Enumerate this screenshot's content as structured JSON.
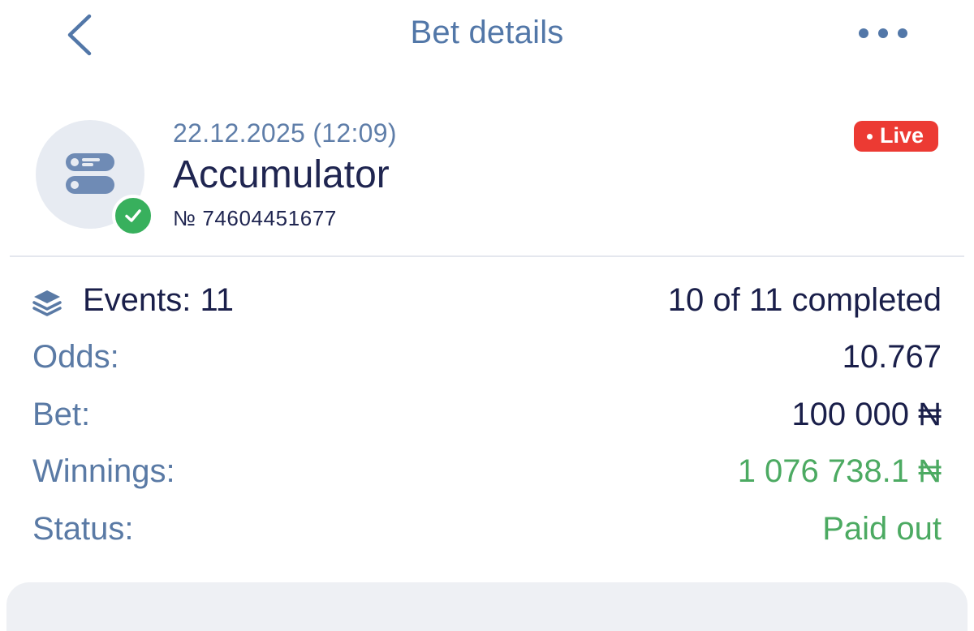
{
  "header": {
    "title": "Bet details",
    "back_icon": "chevron-left-icon",
    "more_icon": "more-horizontal-icon"
  },
  "bet": {
    "date": "22.12.2025 (12:09)",
    "type": "Accumulator",
    "number": "№ 74604451677",
    "icon": "accumulator-icon",
    "status_icon": "check-circle-icon",
    "live_badge": "Live"
  },
  "details": {
    "events": {
      "label": "Events: 11",
      "value": "10 of 11 completed",
      "icon": "layers-icon"
    },
    "odds": {
      "label": "Odds:",
      "value": "10.767"
    },
    "bet": {
      "label": "Bet:",
      "value": "100 000 ₦"
    },
    "winnings": {
      "label": "Winnings:",
      "value": "1 076 738.1 ₦"
    },
    "status": {
      "label": "Status:",
      "value": "Paid out"
    }
  },
  "colors": {
    "accent": "#5277a8",
    "dark_text": "#1a1f4a",
    "success": "#4caa62",
    "live": "#ec3a33"
  }
}
